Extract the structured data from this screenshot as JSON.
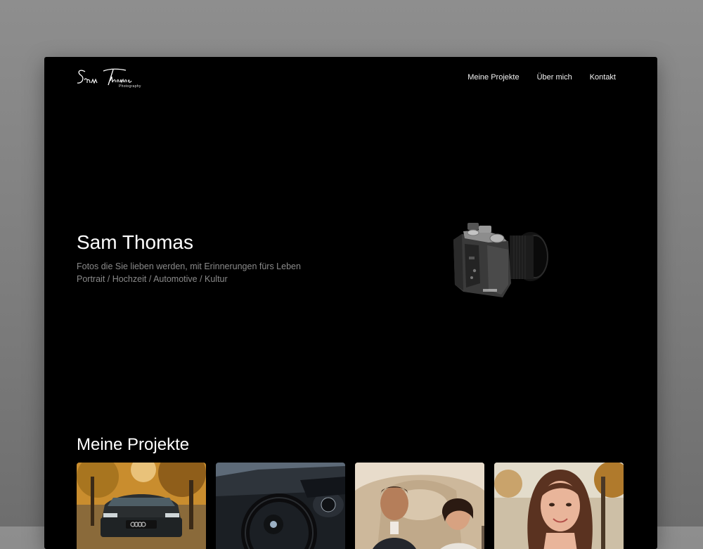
{
  "header": {
    "logo_text": "Sam Thomas",
    "logo_subtext": "Photography"
  },
  "nav": {
    "items": [
      {
        "label": "Meine Projekte"
      },
      {
        "label": "Über mich"
      },
      {
        "label": "Kontakt"
      }
    ]
  },
  "hero": {
    "title": "Sam Thomas",
    "subtitle_line1": "Fotos die Sie lieben werden, mit Erinnerungen fürs Leben",
    "subtitle_line2": "Portrait / Hochzeit / Automotive / Kultur",
    "image": "camera-photo"
  },
  "projects": {
    "title": "Meine Projekte",
    "cards": [
      {
        "image": "car-front-autumn-photo"
      },
      {
        "image": "car-steering-wheel-photo"
      },
      {
        "image": "wedding-couple-photo"
      },
      {
        "image": "woman-portrait-photo"
      }
    ]
  },
  "colors": {
    "page_background": "#000000",
    "text_primary": "#ffffff",
    "text_muted": "#8a8a8a"
  }
}
